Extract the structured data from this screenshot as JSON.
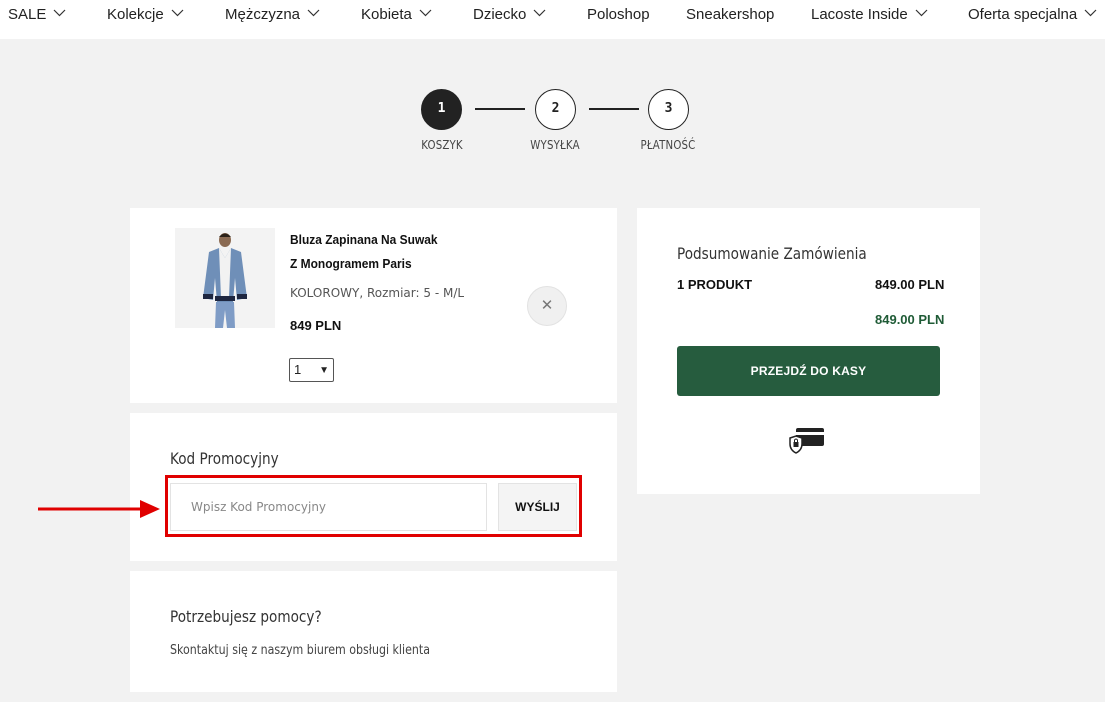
{
  "nav": {
    "items": [
      {
        "label": "SALE",
        "dropdown": true
      },
      {
        "label": "Kolekcje",
        "dropdown": true
      },
      {
        "label": "Mężczyzna",
        "dropdown": true
      },
      {
        "label": "Kobieta",
        "dropdown": true
      },
      {
        "label": "Dziecko",
        "dropdown": true
      },
      {
        "label": "Poloshop",
        "dropdown": false
      },
      {
        "label": "Sneakershop",
        "dropdown": false
      },
      {
        "label": "Lacoste Inside",
        "dropdown": true
      },
      {
        "label": "Oferta specjalna",
        "dropdown": true
      }
    ]
  },
  "steps": [
    {
      "number": "1",
      "label": "KOSZYK",
      "active": true
    },
    {
      "number": "2",
      "label": "WYSYŁKA",
      "active": false
    },
    {
      "number": "3",
      "label": "PŁATNOŚĆ",
      "active": false
    }
  ],
  "cart": {
    "product": {
      "name_line1": "Bluza Zapinana Na Suwak",
      "name_line2": "Z Monogramem Paris",
      "variant": "KOLOROWY, Rozmiar: 5 - M/L",
      "price": "849 PLN",
      "quantity": "1"
    },
    "remove_icon": "close-icon"
  },
  "promo": {
    "title": "Kod Promocyjny",
    "placeholder": "Wpisz Kod Promocyjny",
    "submit_label": "WYŚLIJ"
  },
  "help": {
    "title": "Potrzebujesz pomocy?",
    "text": "Skontaktuj się z naszym biurem obsługi klienta"
  },
  "summary": {
    "title": "Podsumowanie Zamówienia",
    "count_label": "1 PRODUKT",
    "subtotal": "849.00 PLN",
    "total": "849.00 PLN",
    "checkout_label": "PRZEJDŹ DO KASY",
    "secure_icon": "secure-card-icon"
  },
  "colors": {
    "accent_green": "#265c3e",
    "total_green": "#1f5b36",
    "highlight_red": "#e00000"
  }
}
